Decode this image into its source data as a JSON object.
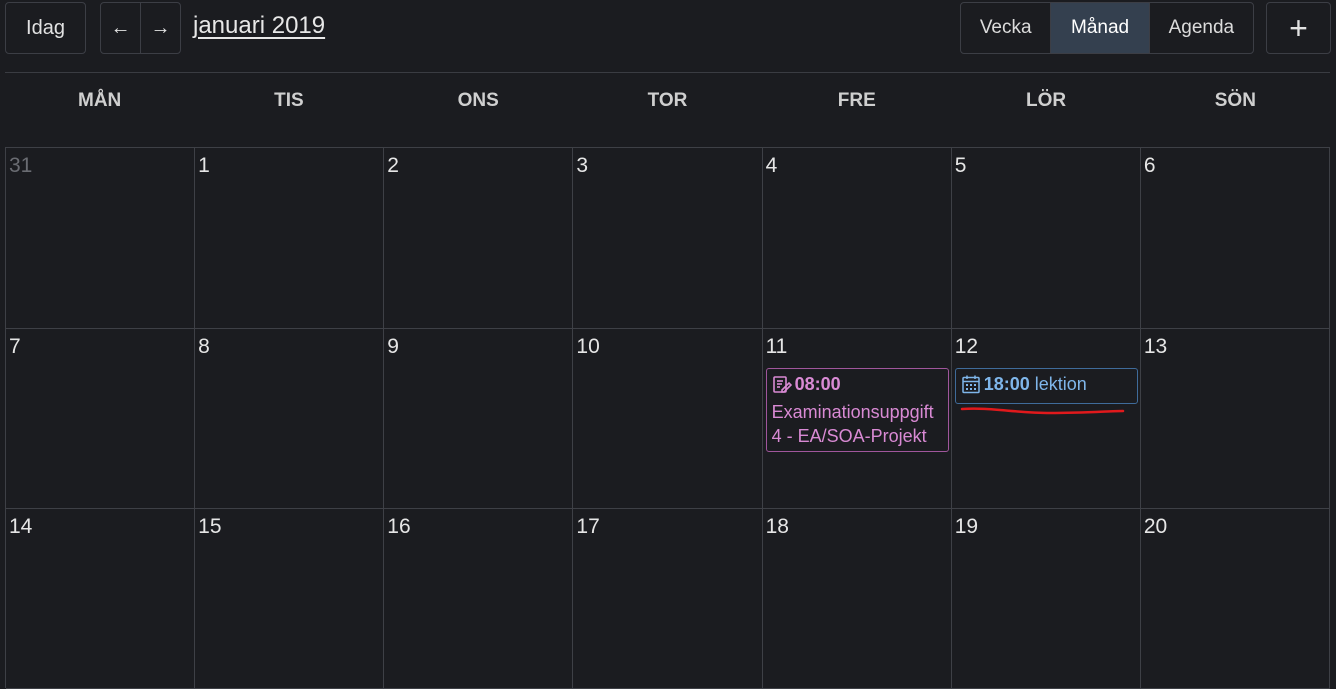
{
  "toolbar": {
    "today_label": "Idag",
    "prev_label": "←",
    "next_label": "→",
    "month_title": "januari 2019",
    "views": [
      "Vecka",
      "Månad",
      "Agenda"
    ],
    "active_view": "Månad",
    "add_label": "+"
  },
  "weekdays": [
    "MÅN",
    "TIS",
    "ONS",
    "TOR",
    "FRE",
    "LÖR",
    "SÖN"
  ],
  "weeks": [
    [
      "31",
      "1",
      "2",
      "3",
      "4",
      "5",
      "6"
    ],
    [
      "7",
      "8",
      "9",
      "10",
      "11",
      "12",
      "13"
    ],
    [
      "14",
      "15",
      "16",
      "17",
      "18",
      "19",
      "20"
    ]
  ],
  "events": {
    "exam": {
      "time": "08:00",
      "title_line1": "Examinationsuppgift",
      "title_line2": "4 - EA/SOA-Projekt",
      "icon": "assignment-edit-icon",
      "color": "#d98ad4"
    },
    "lesson": {
      "time": "18:00",
      "title": "lektion",
      "icon": "calendar-icon",
      "color": "#7fb6ea"
    }
  },
  "colors": {
    "background": "#1b1c20",
    "active_view_bg": "#34404f",
    "annotation_red": "#e0191c"
  }
}
